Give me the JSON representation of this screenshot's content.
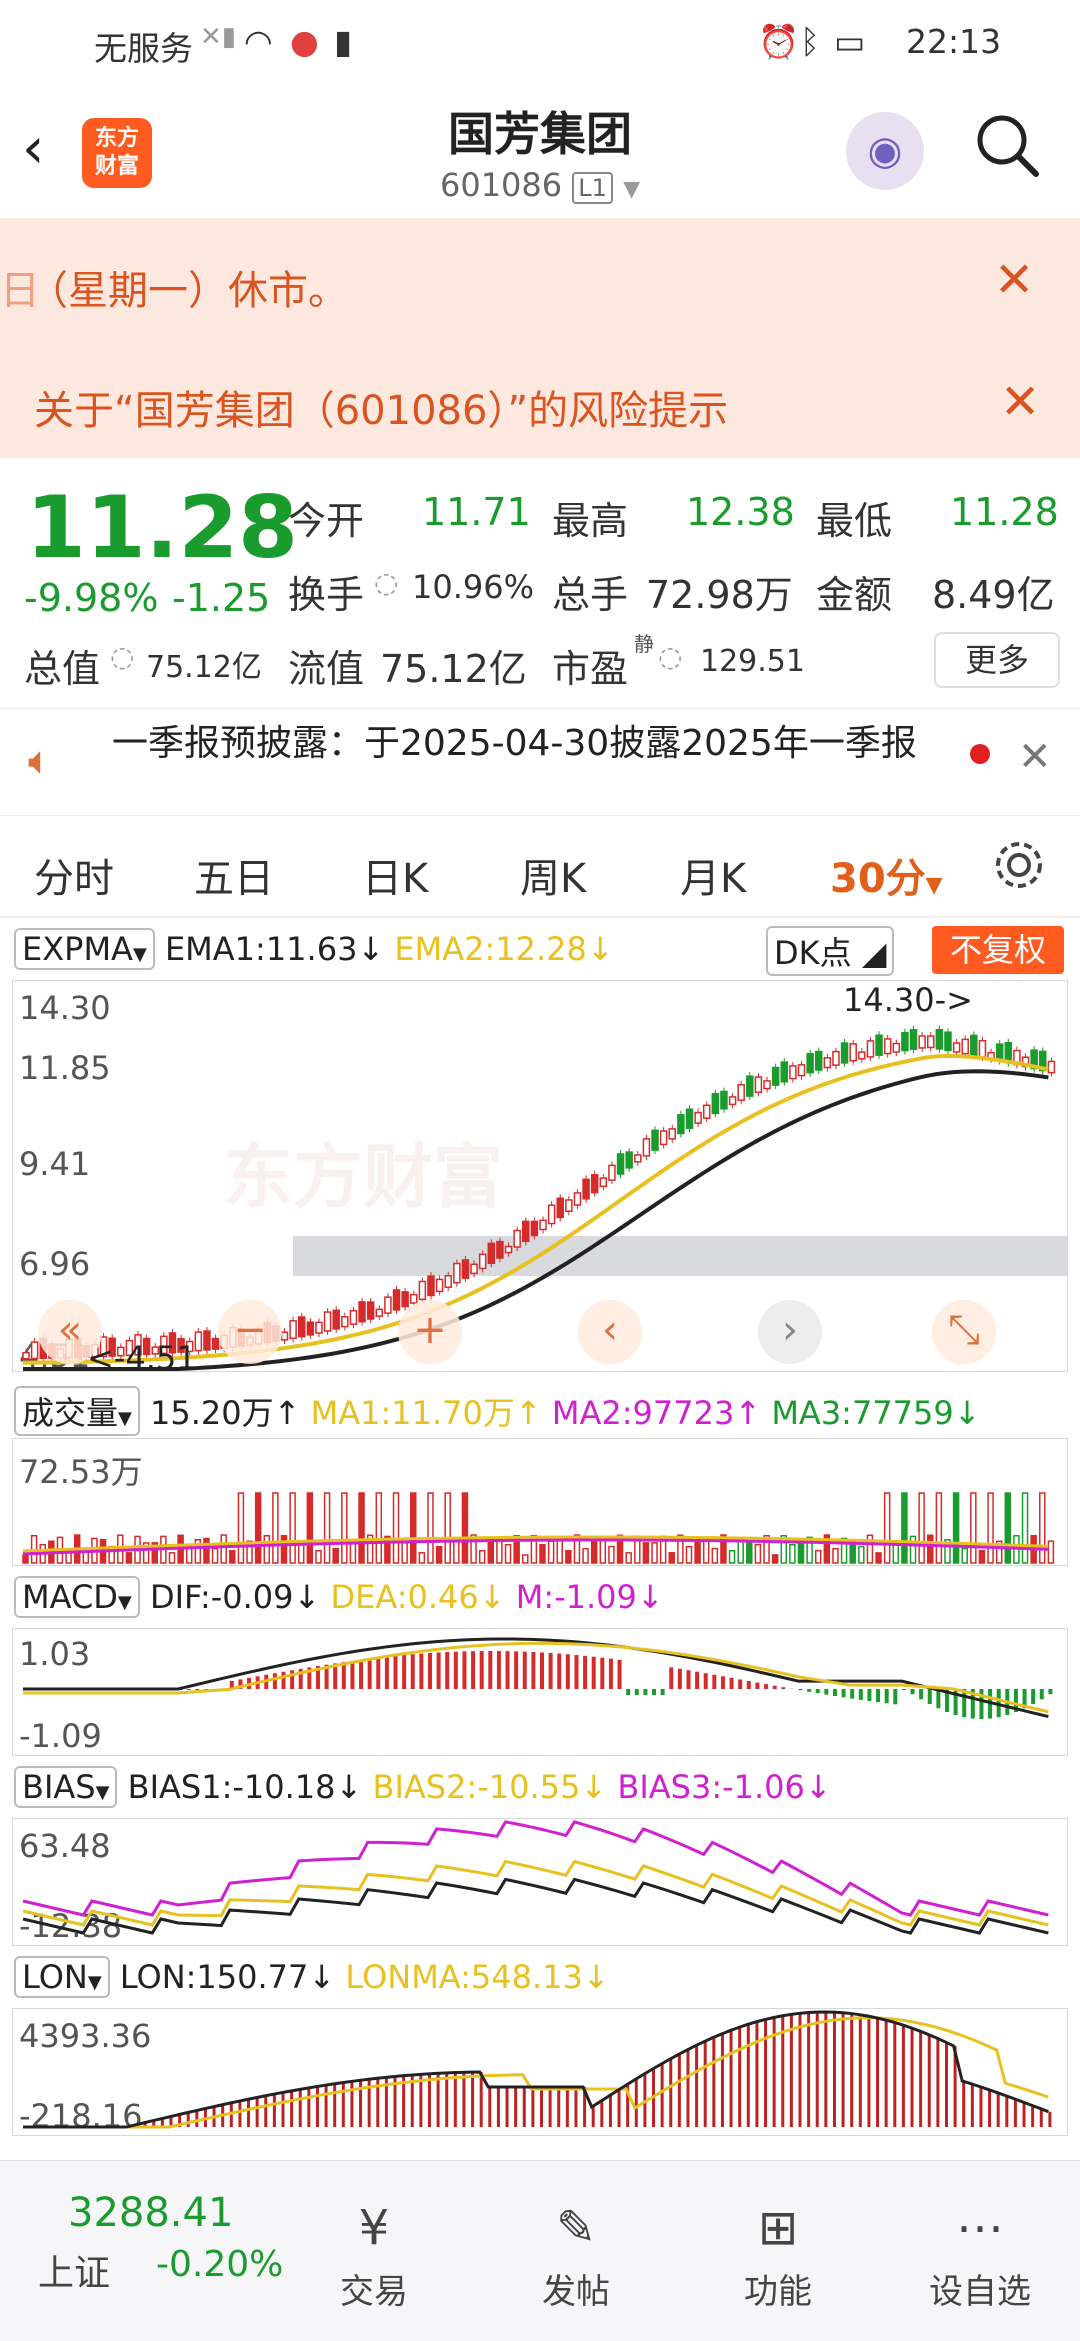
{
  "status_bar": {
    "carrier": "无服务",
    "time": "22:13"
  },
  "header": {
    "title": "国芳集团",
    "code": "601086",
    "level": "L1",
    "logo_text_1": "东方",
    "logo_text_2": "财富"
  },
  "banners": [
    {
      "text": "（星期一）休市。"
    },
    {
      "text": "关于“国芳集团（601086）”的风险提示"
    }
  ],
  "quote": {
    "price": "11.28",
    "change_pct": "-9.98%",
    "change": "-1.25",
    "open_label": "今开",
    "open": "11.71",
    "high_label": "最高",
    "high": "12.38",
    "low_label": "最低",
    "low": "11.28",
    "turnover_label": "换手",
    "turnover": "10.96%",
    "volume_label": "总手",
    "volume": "72.98万",
    "amount_label": "金额",
    "amount": "8.49亿",
    "mktcap_label": "总值",
    "mktcap": "75.12亿",
    "float_label": "流值",
    "float": "75.12亿",
    "pe_label": "市盈",
    "pe_tag": "静",
    "pe": "129.51",
    "more_label": "更多"
  },
  "notice": {
    "text": "一季报预披露：于2025-04-30披露2025年一季报"
  },
  "tabs": [
    "分时",
    "五日",
    "日K",
    "周K",
    "月K",
    "30分"
  ],
  "active_tab": "30分",
  "kline": {
    "indicator": "EXPMA",
    "ema1": "EMA1:11.63",
    "ema2": "EMA2:12.28",
    "dk_label": "DK点",
    "adj_label": "不复权",
    "y_labels": [
      "14.30",
      "11.85",
      "9.41",
      "6.96",
      "4.51"
    ],
    "max_marker": "14.30->",
    "min_marker": "<-4.51",
    "watermark": "东方财富"
  },
  "volume": {
    "indicator": "成交量",
    "value": "15.20万",
    "ma1": "MA1:11.70万",
    "ma2": "MA2:97723",
    "ma3": "MA3:77759",
    "y_label": "72.53万"
  },
  "macd": {
    "indicator": "MACD",
    "dif": "DIF:-0.09",
    "dea": "DEA:0.46",
    "m": "M:-1.09",
    "y_top": "1.03",
    "y_bottom": "-1.09"
  },
  "bias": {
    "indicator": "BIAS",
    "b1": "BIAS1:-10.18",
    "b2": "BIAS2:-10.55",
    "b3": "BIAS3:-1.06",
    "y_top": "63.48",
    "y_bottom": "-12.38"
  },
  "lon": {
    "indicator": "LON",
    "lon": "LON:150.77",
    "lonma": "LONMA:548.13",
    "y_top": "4393.36",
    "y_bottom": "-218.16"
  },
  "bottom_bar": {
    "index_value": "3288.41",
    "index_name": "上证",
    "index_change": "-0.20%",
    "items": [
      "交易",
      "发帖",
      "功能",
      "设自选"
    ]
  },
  "colors": {
    "up": "#d62b2b",
    "down": "#1a9b2d",
    "accent": "#ff5a1f",
    "ema2": "#e8c020",
    "magenta": "#d020d0"
  }
}
